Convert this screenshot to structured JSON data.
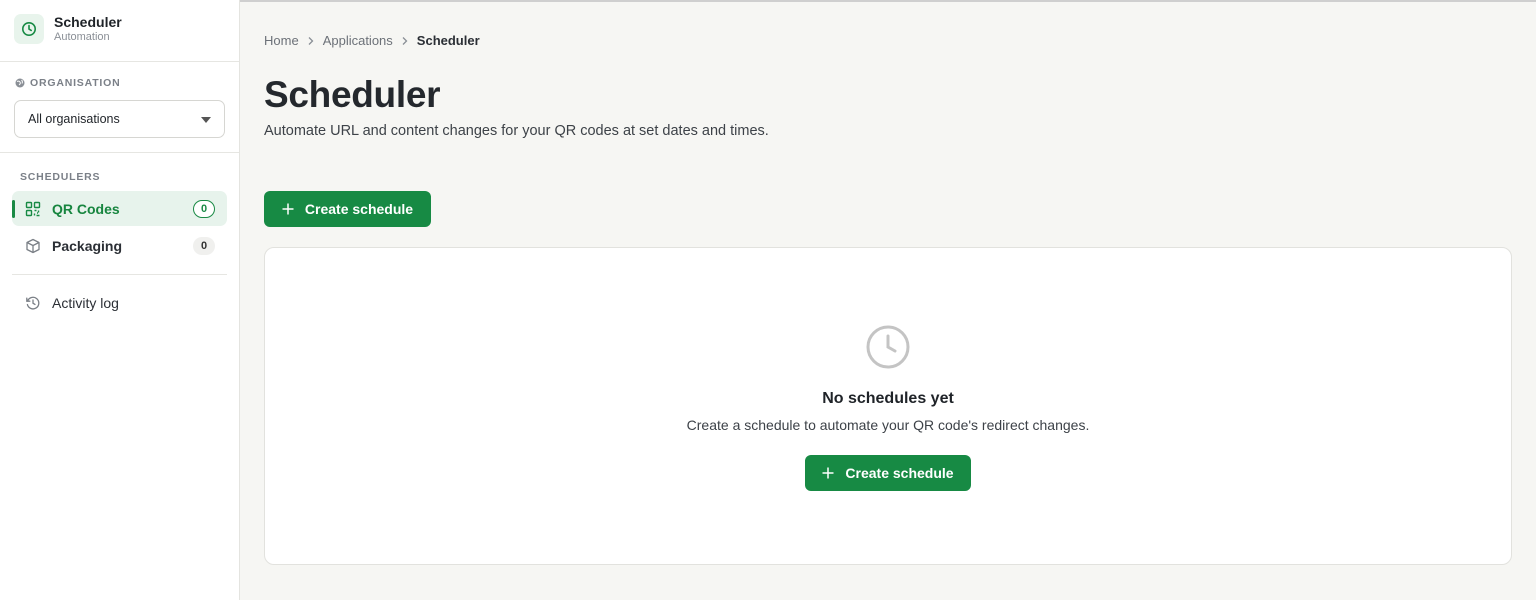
{
  "app": {
    "title": "Scheduler",
    "subtitle": "Automation",
    "icon": "clock-icon",
    "accent": "#178a44"
  },
  "organisation": {
    "label": "ORGANISATION",
    "selected": "All organisations"
  },
  "sidebar": {
    "section_label": "SCHEDULERS",
    "items": [
      {
        "label": "QR Codes",
        "count": "0",
        "icon": "qr-code-icon",
        "active": true
      },
      {
        "label": "Packaging",
        "count": "0",
        "icon": "box-icon",
        "active": false
      }
    ],
    "activity_log": {
      "label": "Activity log",
      "icon": "history-icon"
    }
  },
  "breadcrumb": {
    "items": [
      "Home",
      "Applications",
      "Scheduler"
    ]
  },
  "main": {
    "title": "Scheduler",
    "description": "Automate URL and content changes for your QR codes at set dates and times.",
    "create_button": "Create schedule"
  },
  "empty_state": {
    "icon": "clock-icon",
    "title": "No schedules yet",
    "description": "Create a schedule to automate your QR code's redirect changes.",
    "button": "Create schedule"
  }
}
